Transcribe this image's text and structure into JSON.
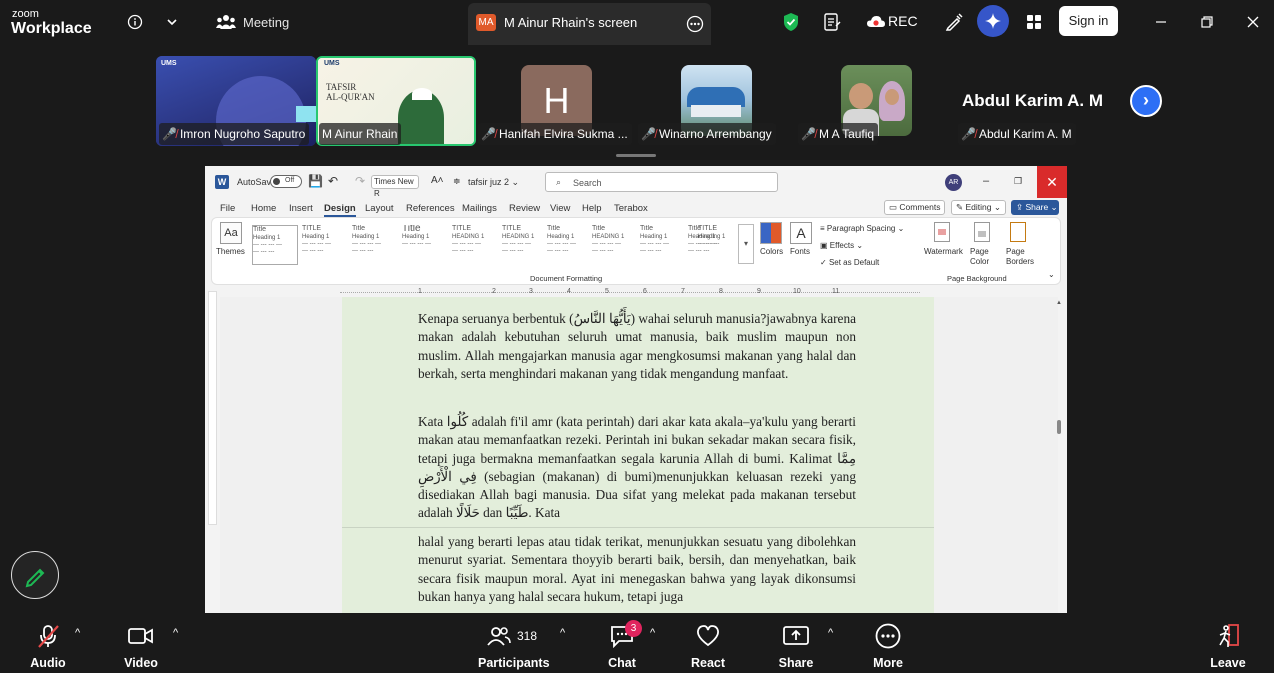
{
  "app": {
    "brand_small": "zoom",
    "brand_big": "Workplace"
  },
  "topbar": {
    "meeting_label": "Meeting",
    "screen_tab_badge": "MA",
    "screen_tab_label": "M Ainur Rhain's screen",
    "rec_label": "REC",
    "signin_label": "Sign in"
  },
  "participants": [
    {
      "name": "Imron Nugroho Saputro"
    },
    {
      "name": "M Ainur Rhain"
    },
    {
      "name": "Hanifah Elvira Sukma ...",
      "initial": "H"
    },
    {
      "name": "Winarno Arrembangy"
    },
    {
      "name": "M A Taufiq"
    },
    {
      "name": "Abdul Karim A. M",
      "display": "Abdul Karim A. M"
    }
  ],
  "word": {
    "autosave": "AutoSave",
    "autosave_state": "Off",
    "font_box": "Times New R",
    "doc_title": "tafsir juz 2 ⌄",
    "search_placeholder": "Search",
    "avatar": "AR",
    "menu": [
      "File",
      "Home",
      "Insert",
      "Design",
      "Layout",
      "References",
      "Mailings",
      "Review",
      "View",
      "Help",
      "Terabox"
    ],
    "comments": "Comments",
    "editing": "Editing",
    "share": "Share",
    "themes": "Themes",
    "colors": "Colors",
    "fonts": "Fonts",
    "paragraph_spacing": "Paragraph Spacing",
    "effects": "Effects",
    "set_default": "Set as Default",
    "watermark": "Watermark",
    "page_color": "Page Color",
    "page_borders": "Page Borders",
    "doc_formatting": "Document Formatting",
    "page_background": "Page Background",
    "style_cards": [
      "Title",
      "TITLE",
      "Title",
      "Title",
      "TITLE",
      "TITLE",
      "Title",
      "Title",
      "Title",
      "Title",
      "TITLE"
    ],
    "ruler_numbers": [
      "1",
      "2",
      "3",
      "4",
      "5",
      "6",
      "7",
      "8",
      "9",
      "10",
      "11"
    ]
  },
  "document": {
    "para1": "Kenapa seruanya berbentuk (يَأَيُّهَا النَّاسُ) wahai seluruh manusia?jawabnya karena makan adalah kebutuhan seluruh umat manusia, baik muslim maupun non muslim. Allah mengajarkan manusia agar mengkosumsi makanan yang halal dan berkah, serta menghindari makanan yang tidak mengandung manfaat.",
    "para2": "Kata كُلُوا adalah fi'il amr (kata perintah) dari akar kata akala–ya'kulu yang berarti makan atau memanfaatkan rezeki. Perintah ini bukan sekadar makan secara fisik, tetapi juga bermakna memanfaatkan segala karunia Allah di bumi. Kalimat مِمَّا فِي الْأَرْضِ (sebagian (makanan) di bumi)menunjukkan keluasan rezeki yang disediakan Allah bagi manusia. Dua sifat yang melekat pada makanan tersebut adalah حَلَالًا dan طَيِّبًا. Kata",
    "para3": "halal yang berarti lepas atau tidak terikat, menunjukkan sesuatu yang dibolehkan menurut syariat. Sementara thoyyib berarti baik, bersih, dan menyehatkan, baik secara fisik maupun moral. Ayat ini menegaskan bahwa yang layak dikonsumsi bukan hanya yang halal secara hukum, tetapi juga"
  },
  "bottombar": {
    "audio": "Audio",
    "video": "Video",
    "participants": "Participants",
    "participant_count": "318",
    "chat": "Chat",
    "chat_badge": "3",
    "react": "React",
    "share": "Share",
    "more": "More",
    "leave": "Leave"
  }
}
